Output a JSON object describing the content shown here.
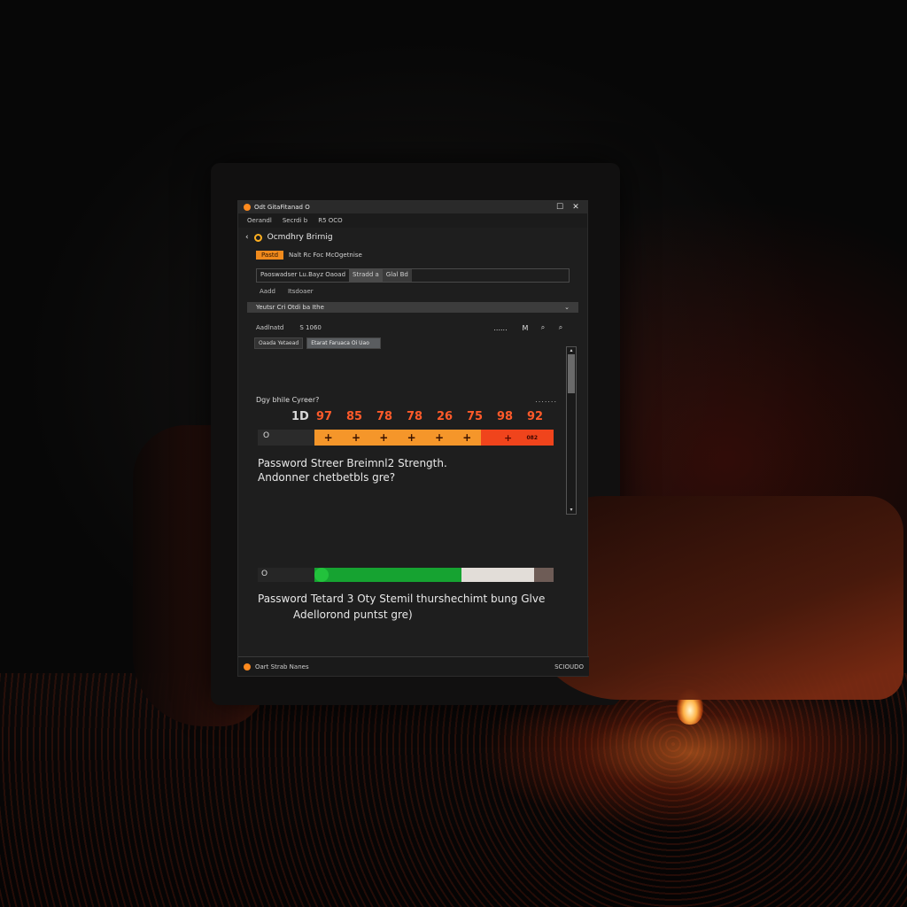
{
  "window": {
    "title": "Odt GitaFitanad O",
    "menu": [
      "Oerandl",
      "Secrdi b",
      "R5 OCO"
    ]
  },
  "nav": {
    "back": "‹",
    "title": "Ocmdhry Brirnig"
  },
  "badge": {
    "label": "Pastd",
    "text": "Nalt Rc Foc McOgetnise"
  },
  "input": {
    "segment1": "Paoswadser Lu.Bayz Oaoad",
    "segment2": "Stradd a",
    "segment3": "Glal Bd"
  },
  "tabs": [
    "Aadd",
    "Itsdoaer"
  ],
  "dropdown": {
    "label": "Yeutsr Cri Otdi ba Ithe",
    "chevron": "⌄"
  },
  "toolbar": {
    "left": "Aadlnatd",
    "mid": "S 1060",
    "dots": "......",
    "m": "M"
  },
  "buttons": {
    "b1": "Oaada Yetaead",
    "b2": "Etarat Faruaca Oi Uao"
  },
  "strength1": {
    "section_title": "Dgy bhile Cyreer?",
    "dots": ".......",
    "numbers": [
      "1D",
      "97",
      "85",
      "78",
      "78",
      "26",
      "75",
      "98",
      "92"
    ],
    "zero": "O",
    "plus_marks": [
      "+",
      "+",
      "+",
      "+",
      "+",
      "+"
    ],
    "red_plus": "+",
    "red_tag": "082",
    "caption_line1": "Password Streer Breimnl2 Strength.",
    "caption_line2": "Andonner chetbetbls gre?"
  },
  "strength2": {
    "zero": "O",
    "level": 0.7,
    "caption_line1": "Password Tetard 3 Oty Stemil thurshechimt bung Glve",
    "caption_line2": "Adellorond puntst gre)"
  },
  "footer": {
    "left": "Oart Strab Nanes",
    "right": "SCIOUDO"
  },
  "colors": {
    "accent_orange": "#f5962a",
    "accent_red": "#f0441c",
    "accent_green": "#16a331",
    "window_bg": "#1e1e1e"
  }
}
